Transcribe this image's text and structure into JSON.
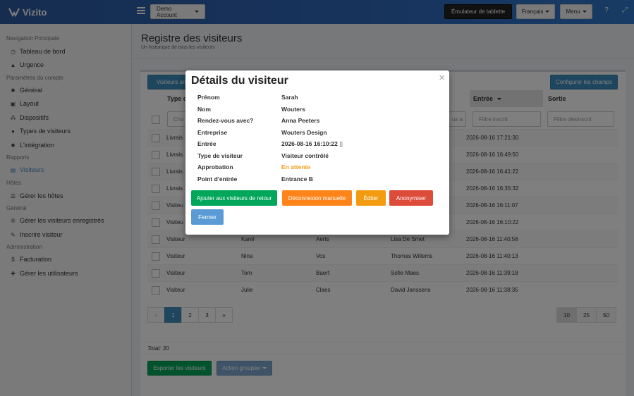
{
  "app": {
    "name": "Vizito"
  },
  "topbar": {
    "account": "Demo Account",
    "tablet": "Émulateur de tablette",
    "language": "Français",
    "menu": "Menu",
    "help_icon": "question-circle-icon",
    "expand_icon": "expand-icon"
  },
  "sidebar": {
    "sec_nav": "Navigation Principale",
    "dashboard": "Tableau de bord",
    "urgent": "Urgence",
    "sec_account": "Paramètres du compte",
    "general": "Général",
    "layout": "Layout",
    "devices": "Dispositifs",
    "visitor_types": "Types de visiteurs",
    "integration": "L'intégration",
    "sec_reports": "Rapports",
    "visitors": "Visiteurs",
    "sec_hosts": "Hôtes",
    "manage_hosts": "Gérer les hôtes",
    "sec_general": "Général",
    "manage_registered": "Gérer les visiteurs enregistrés",
    "register_visitor": "Inscrire visiteur",
    "sec_admin": "Administration",
    "billing": "Facturation",
    "manage_users": "Gérer les utilisateurs"
  },
  "page": {
    "title": "Registre des visiteurs",
    "subtitle": "Un historique de tous les visiteurs"
  },
  "toolbar": {
    "visitors_arriving": "Visiteurs arri",
    "configure_fields": "Configurer les champs"
  },
  "table": {
    "col_type": "Type d",
    "col_entry": "Entrée",
    "col_exit": "Sortie",
    "filter_type": "Cho",
    "filter_partial": "us a",
    "filter_in": "Filtre inscrit",
    "filter_out": "Filtre désinscrit",
    "rows": [
      {
        "type": "Livrais",
        "first": "",
        "last": "",
        "host": "",
        "entry": "2026-08-16 17:21:30"
      },
      {
        "type": "Livrais",
        "first": "",
        "last": "",
        "host": "",
        "entry": "2026-08-16 16:49:50"
      },
      {
        "type": "Livrais",
        "first": "",
        "last": "",
        "host": "",
        "entry": "2026-08-16 16:41:22"
      },
      {
        "type": "Livrais",
        "first": "",
        "last": "",
        "host": "",
        "entry": "2026-08-16 16:35:32"
      },
      {
        "type": "Visiteu",
        "first": "",
        "last": "",
        "host": "",
        "entry": "2026-08-16 16:11:07"
      },
      {
        "type": "Visiteu",
        "first": "",
        "last": "",
        "host": "",
        "entry": "2026-08-16 16:10:22"
      },
      {
        "type": "Visiteur",
        "first": "Karel",
        "last": "Aerts",
        "host": "Lisa De Smet",
        "entry": "2026-08-16 11:40:56"
      },
      {
        "type": "Visiteur",
        "first": "Nina",
        "last": "Vos",
        "host": "Thomas Willems",
        "entry": "2026-08-16 11:40:13"
      },
      {
        "type": "Visiteur",
        "first": "Tom",
        "last": "Baert",
        "host": "Sofie Maes",
        "entry": "2026-08-16 11:39:18"
      },
      {
        "type": "Visiteur",
        "first": "Julie",
        "last": "Claes",
        "host": "David Janssens",
        "entry": "2026-08-16 11:38:35"
      }
    ]
  },
  "pagination": {
    "prev": "«",
    "pages": [
      "1",
      "2",
      "3"
    ],
    "next": "»",
    "current": 1,
    "sizes": [
      "10",
      "25",
      "50"
    ]
  },
  "footer": {
    "total": "Total: 30",
    "export": "Exporter les visiteurs",
    "bulk": "Action groupée"
  },
  "modal": {
    "title": "Détails du visiteur",
    "close": "×",
    "fields": [
      {
        "label": "Prénom",
        "value": "Sarah"
      },
      {
        "label": "Nom",
        "value": "Wouters"
      },
      {
        "label": "Rendez-vous avec?",
        "value": "Anna Peeters"
      },
      {
        "label": "Entreprise",
        "value": "Wouters Design"
      },
      {
        "label": "Entrée",
        "value": "2026-08-16 16:10:22"
      },
      {
        "label": "Type de visiteur",
        "value": "Visiteur contrôlé"
      },
      {
        "label": "Approbation",
        "value": "En attente"
      },
      {
        "label": "Point d'entrée",
        "value": "Entrance B"
      }
    ],
    "entry_icon": "tablet-icon",
    "btn_return": "Ajouter aux visiteurs de retour",
    "btn_logout": "Déconnexion manuelle",
    "btn_edit": "Éditer",
    "btn_anon": "Anonymiser",
    "btn_close": "Fermer",
    "colors": {
      "green": "#00a65a",
      "orange": "#ff851b",
      "amber": "#f39c12",
      "red": "#dd4b39",
      "blue": "#5b9bd5"
    }
  }
}
